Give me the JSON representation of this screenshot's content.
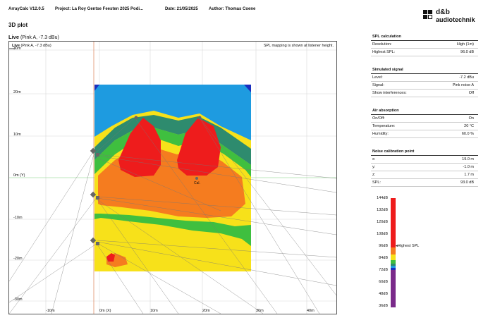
{
  "header": {
    "app": "ArrayCalc V12.0.5",
    "project": "Project: La Roy Gentse Feesten 2025 Podi...",
    "date": "Date: 21/05/2025",
    "author": "Author: Thomas Coene"
  },
  "logo": {
    "line1": "d&b",
    "line2": "audiotechnik"
  },
  "page_title": "3D plot",
  "subtitle": {
    "mode": "Live",
    "detail": "(Pink A, -7.3 dBu)"
  },
  "plot": {
    "mode": "Live",
    "detail": "(Pink A, -7.3 dBu)",
    "note": "SPL mapping is shown at listener height.",
    "y_labels": [
      "30m",
      "20m",
      "10m",
      "0m (Y)",
      "-10m",
      "-20m",
      "-30m"
    ],
    "x_labels": [
      "-10m",
      "0m (X)",
      "10m",
      "20m",
      "30m",
      "40m"
    ],
    "cal_label": "Cal."
  },
  "panels": {
    "spl": {
      "title": "SPL calculation",
      "rows": [
        {
          "label": "Resolution:",
          "value": "High (1m)"
        },
        {
          "label": "Highest SPL:",
          "value": "96.0 dB"
        }
      ]
    },
    "signal": {
      "title": "Simulated signal",
      "rows": [
        {
          "label": "Level:",
          "value": "-7.2 dBu"
        },
        {
          "label": "Signal:",
          "value": "Pink noise A"
        },
        {
          "label": "Show interferences:",
          "value": "Off"
        }
      ]
    },
    "air": {
      "title": "Air absorption",
      "rows": [
        {
          "label": "On/Off:",
          "value": "On"
        },
        {
          "label": "Temperature:",
          "value": "20 °C"
        },
        {
          "label": "Humidity:",
          "value": "60.0 %"
        }
      ]
    },
    "noise": {
      "title": "Noise calibration point",
      "rows": [
        {
          "label": "x:",
          "value": "19.0 m"
        },
        {
          "label": "y:",
          "value": "-1.0 m"
        },
        {
          "label": "z:",
          "value": "1.7 m"
        },
        {
          "label": "SPL:",
          "value": "93.0 dB"
        }
      ]
    }
  },
  "scale": {
    "ticks": [
      "144dB",
      "132dB",
      "120dB",
      "108dB",
      "96dB",
      "84dB",
      "72dB",
      "60dB",
      "48dB",
      "36dB"
    ],
    "highest_label": "Highest SPL",
    "colors": {
      "red": "#ee1c1c",
      "orange": "#f57c1f",
      "yellow": "#f7e11a",
      "green": "#3fbf3f",
      "teal": "#2e8b6e",
      "blue": "#1e9be0",
      "navy": "#1a2fbf",
      "purple": "#7a2a8a"
    }
  }
}
